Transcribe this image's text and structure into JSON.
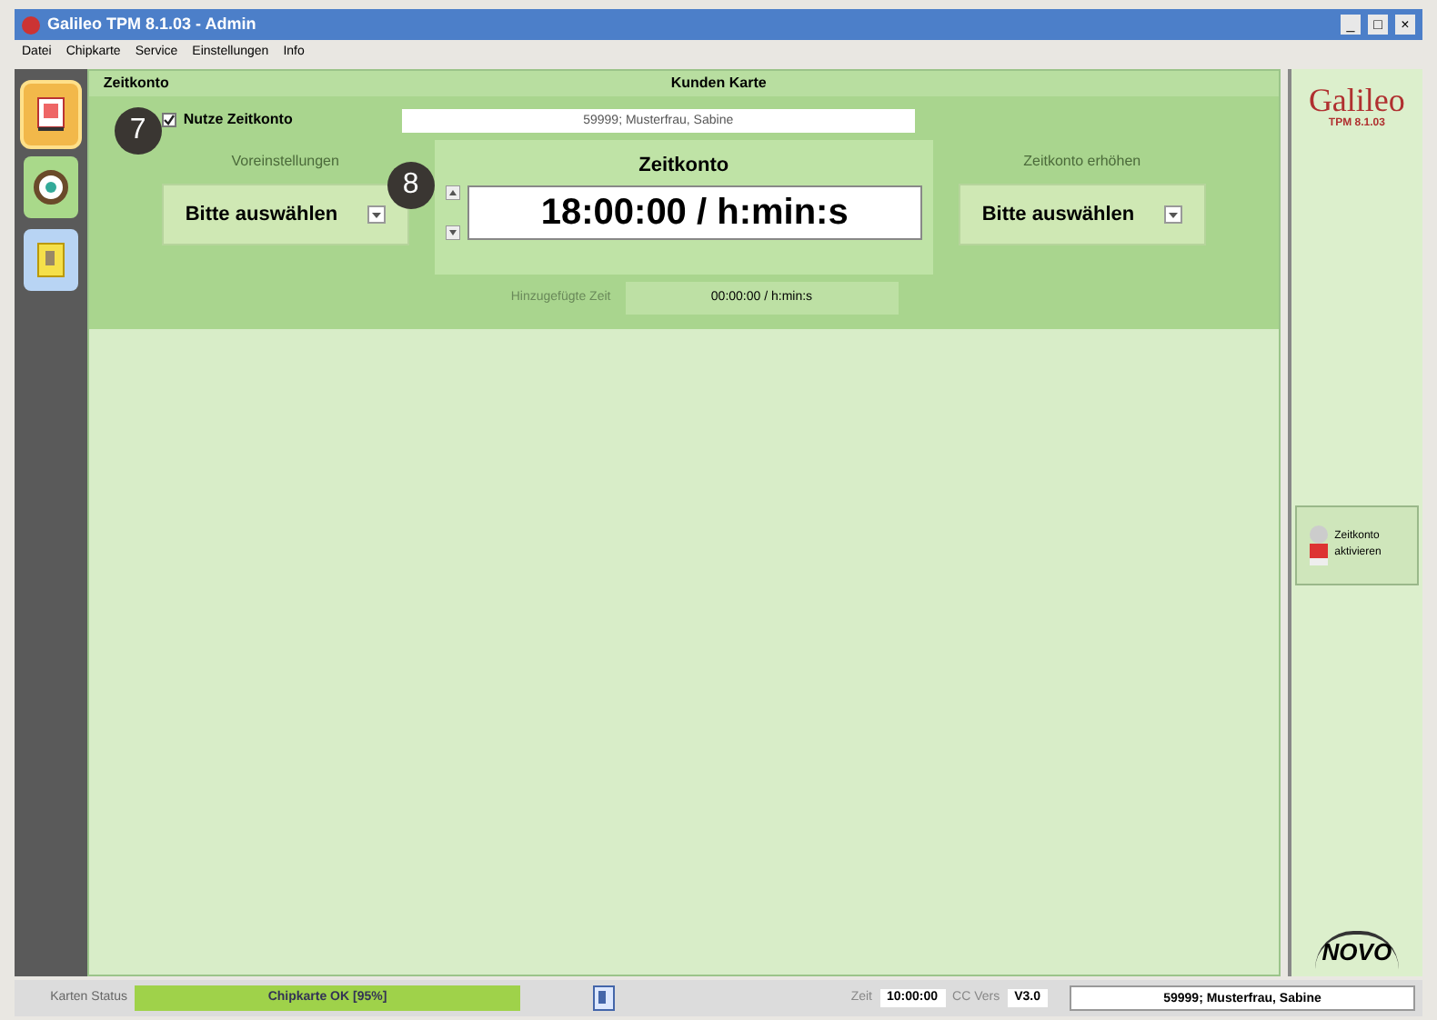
{
  "window": {
    "title": "Galileo TPM 8.1.03 - Admin",
    "controls": [
      "_",
      "□",
      "×"
    ]
  },
  "menu": [
    "Datei",
    "Chipkarte",
    "Service",
    "Einstellungen",
    "Info"
  ],
  "toolbar": [
    {
      "kind": "card",
      "selected": true
    },
    {
      "kind": "clock",
      "selected": false
    },
    {
      "kind": "p",
      "selected": false
    }
  ],
  "panel": {
    "title": "Zeitkonto",
    "heading": "Kunden Karte",
    "use_account": {
      "label": "Nutze Zeitkonto",
      "checked": true
    },
    "customer": "59999; Musterfrau, Sabine",
    "presets": {
      "label": "Voreinstellungen",
      "value": "Bitte auswählen"
    },
    "account": {
      "label": "Zeitkonto",
      "value": "18:00:00 / h:min:s"
    },
    "increase": {
      "label": "Zeitkonto erhöhen",
      "value": "Bitte auswählen"
    },
    "added": {
      "label": "Hinzugefügte Zeit",
      "value": "00:00:00 / h:min:s"
    },
    "callouts": [
      "7",
      "8"
    ]
  },
  "side": {
    "logo": "Galileo",
    "logo_sub": "TPM 8.1.03",
    "button": "Zeitkonto aktivieren",
    "brand": "NOVO"
  },
  "status_bar": {
    "card_label": "Karten Status",
    "card_status": "Chipkarte OK [95%]",
    "time_label": "Zeit",
    "time": "10:00:00",
    "cc_label": "CC Vers",
    "cc": "V3.0",
    "customer": "59999; Musterfrau, Sabine"
  }
}
